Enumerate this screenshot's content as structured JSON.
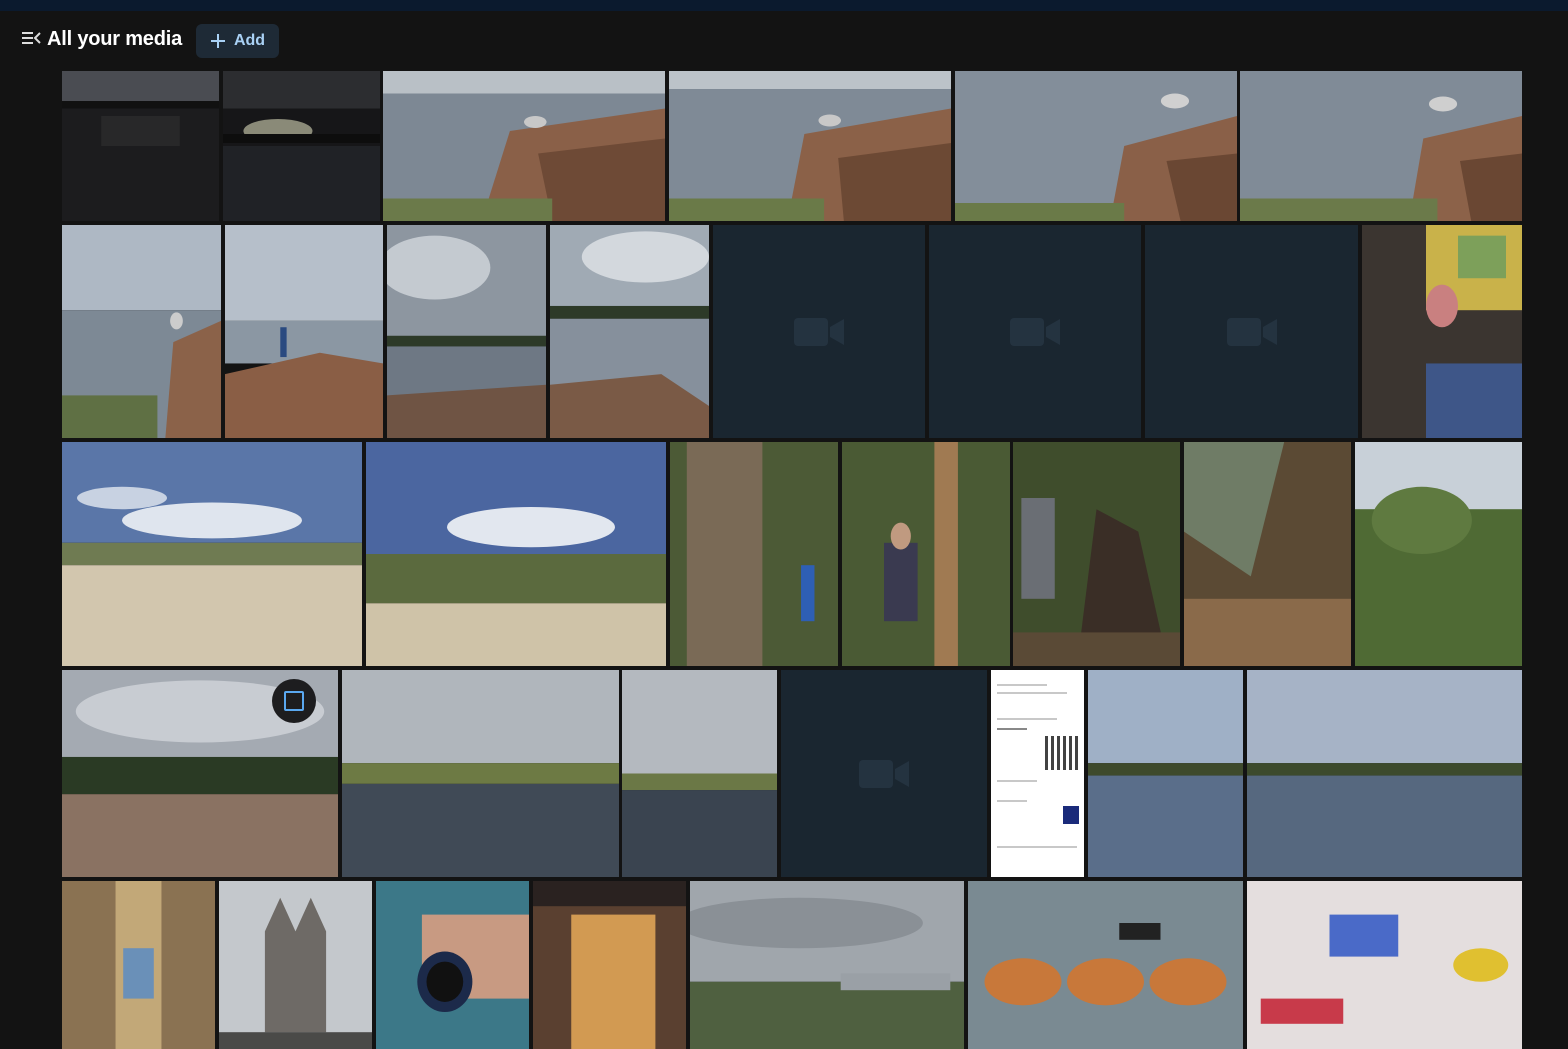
{
  "header": {
    "title": "All your media",
    "add_label": "Add"
  },
  "icons": {
    "menu": "menu-collapse-icon",
    "add": "plus-icon",
    "video": "video-camera-icon",
    "select": "select-checkbox-icon"
  },
  "colors": {
    "background": "#131313",
    "accent": "#a9d1f5",
    "button_bg": "#1e2a36",
    "video_placeholder": "#1a2630"
  }
}
